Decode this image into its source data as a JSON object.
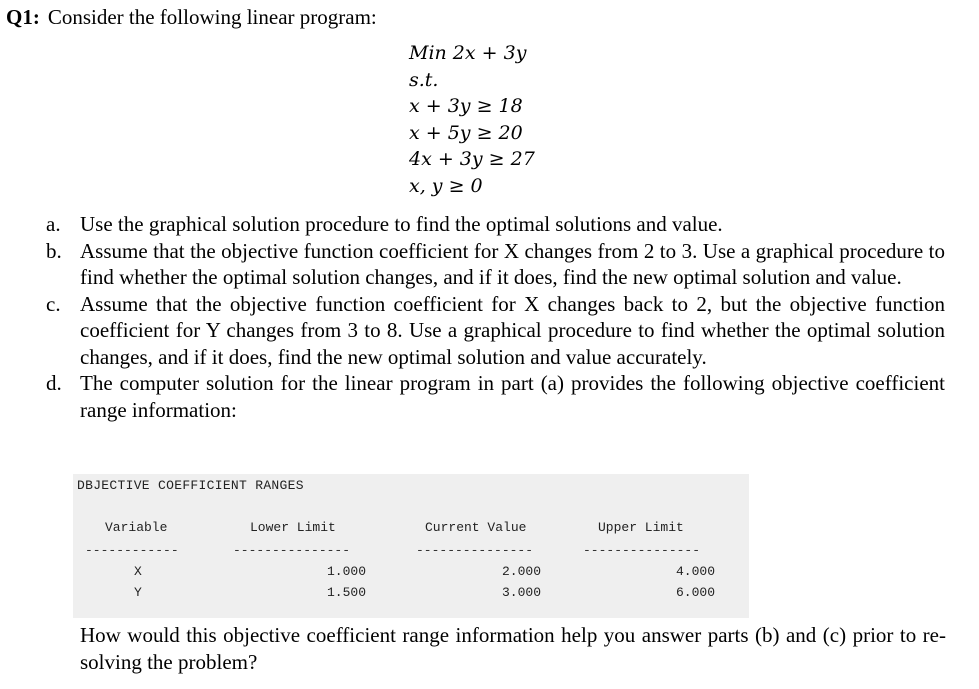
{
  "question": {
    "label": "Q1:",
    "prompt": "Consider the following linear program:"
  },
  "linear_program": {
    "objective": "Min 2x + 3y",
    "subject_to": "s.t.",
    "constraints": [
      "x + 3y ≥ 18",
      "x + 5y ≥ 20",
      "4x + 3y ≥ 27",
      "x, y ≥ 0"
    ]
  },
  "parts": [
    {
      "label": "a.",
      "text": "Use the graphical solution procedure to find the optimal solutions and value."
    },
    {
      "label": "b.",
      "text": "Assume that the objective function coefficient for X changes from 2 to 3. Use a graphical procedure to find whether the optimal solution changes, and if it does, find the new optimal solution and value."
    },
    {
      "label": "c.",
      "text": "Assume that the objective function coefficient for X changes back to 2, but the objective function coefficient for Y changes from 3 to 8. Use a graphical procedure to find whether the optimal solution changes, and if it does, find the new optimal solution and value accurately."
    },
    {
      "label": "d.",
      "text": "The computer solution for the linear program in part (a) provides the following objective coefficient range information:"
    }
  ],
  "ranges_table": {
    "heading": "OBJECTIVE COEFFICIENT RANGES",
    "heading_visible": "DBJECTIVE COEFFICIENT RANGES",
    "columns": [
      "Variable",
      "Lower Limit",
      "Current Value",
      "Upper Limit"
    ],
    "separators": [
      "------------",
      "---------------",
      "---------------",
      "---------------"
    ],
    "rows": [
      {
        "variable": "X",
        "lower": "1.000",
        "current": "2.000",
        "upper": "4.000"
      },
      {
        "variable": "Y",
        "lower": "1.500",
        "current": "3.000",
        "upper": "6.000"
      }
    ]
  },
  "closing_question": "How would this objective coefficient range information help you answer parts (b) and (c) prior to re-solving the problem?"
}
